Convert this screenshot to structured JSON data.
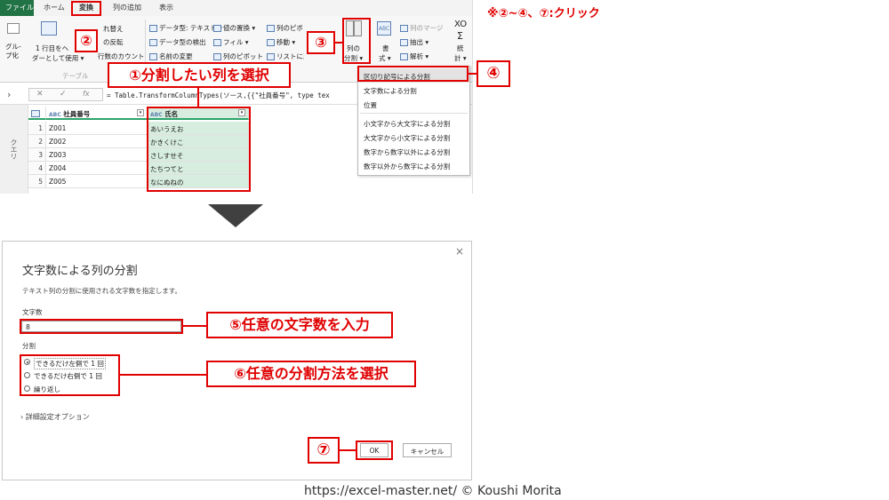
{
  "note": "※②~④、⑦:クリック",
  "ribbon": {
    "tabs": [
      "ファイル",
      "ホーム",
      "変換",
      "列の追加",
      "表示"
    ],
    "active_tab": "変換",
    "table_group": {
      "group_label": "グル-プ化",
      "first_row_line1": "1 行目をヘ",
      "first_row_line2": "ダーとして使用 ▾",
      "transpose": "れ替え",
      "reverse_rows": "の反転",
      "count_rows": "行数のカウント",
      "caption": "テーブル"
    },
    "any_column": {
      "data_type": "データ型: テキスト ▾",
      "detect_type": "データ型の検出",
      "rename": "名前の変更",
      "replace_values": "値の置換 ▾",
      "fill": "フィル ▾",
      "pivot": "列のピボット",
      "unpivot": "列のピボット解除",
      "move": "移動 ▾",
      "to_list": "リストに変換"
    },
    "split_column_line1": "列の",
    "split_column_line2": "分割 ▾",
    "format_line1": "書",
    "format_line2": "式 ▾",
    "merge_columns": "列のマージ",
    "extract": "抽出 ▾",
    "parse": "解析 ▾",
    "stats_line1": "統",
    "stats_line2": "計 ▾",
    "xo_icon": "XO",
    "sigma_icon": "Σ"
  },
  "formula_bar": {
    "cancel_icon": "✕",
    "confirm_icon": "✓",
    "fx": "fx",
    "formula_prefix": "= Table.TransformColumnTypes(ソース,{{\"社員番号\", type tex"
  },
  "query_pane": {
    "collapse": "›",
    "label": "クエリ"
  },
  "grid": {
    "headers": [
      "社員番号",
      "氏名"
    ],
    "type_icon": "ABC",
    "row_numbers": [
      "1",
      "2",
      "3",
      "4",
      "5"
    ],
    "col1": [
      "Z001",
      "Z002",
      "Z003",
      "Z004",
      "Z005"
    ],
    "col2": [
      "あいうえお",
      "かきくけこ",
      "さしすせそ",
      "たちつてと",
      "なにぬねの"
    ]
  },
  "split_menu": {
    "items": [
      "区切り記号による分割",
      "文字数による分割",
      "位置",
      "小文字から大文字による分割",
      "大文字から小文字による分割",
      "数字から数字以外による分割",
      "数字以外から数字による分割"
    ]
  },
  "dialog": {
    "title": "文字数による列の分割",
    "description": "テキスト列の分割に使用される文字数を指定します。",
    "chars_label": "文字数",
    "chars_value": "8",
    "split_label": "分割",
    "options": [
      "できるだけ左側で 1 回",
      "できるだけ右側で 1 回",
      "繰り返し"
    ],
    "selected_option": 0,
    "advanced": "詳細設定オプション",
    "ok": "OK",
    "cancel": "キャンセル",
    "close_icon": "×"
  },
  "callouts": {
    "c1": "①分割したい列を選択",
    "c2": "②",
    "c3": "③",
    "c4": "④",
    "c5": "⑤任意の文字数を入力",
    "c6": "⑥任意の分割方法を選択",
    "c7": "⑦"
  },
  "credit": "https://excel-master.net/ © Koushi Morita",
  "colors": {
    "accent_red": "#e00000",
    "selection_green": "#d7eddf",
    "header_underline": "#2ea36b"
  }
}
